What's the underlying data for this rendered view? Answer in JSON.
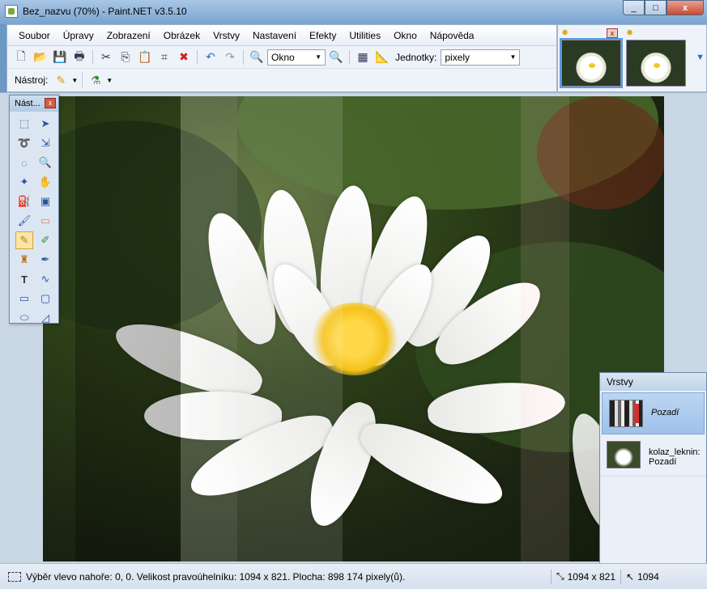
{
  "window": {
    "title": "Bez_nazvu (70%) - Paint.NET v3.5.10",
    "buttons": [
      "_",
      "□",
      "x"
    ]
  },
  "menu": [
    "Soubor",
    "Úpravy",
    "Zobrazení",
    "Obrázek",
    "Vrstvy",
    "Nastavení",
    "Efekty",
    "Utilities",
    "Okno",
    "Nápověda"
  ],
  "toolbar": {
    "zoom_value": "Okno",
    "units_label": "Jednotky:",
    "units_value": "pixely",
    "tool_label": "Nástroj:"
  },
  "tools_palette": {
    "title": "Nást...",
    "close": "x"
  },
  "layers_panel": {
    "title": "Vrstvy",
    "layers": [
      {
        "name": "Pozadí"
      },
      {
        "name": "kolaz_leknin: Pozadí"
      }
    ]
  },
  "statusbar": {
    "selection_text": "Výběr vlevo nahoře: 0, 0. Velikost pravoúhelníku: 1094 x 821. Plocha: 898 174 pixely(ů).",
    "image_size": "1094 x 821",
    "cursor_pos": "1094"
  },
  "colors": {
    "accent": "#5c9ae0",
    "window_bg": "#eef3f9"
  }
}
